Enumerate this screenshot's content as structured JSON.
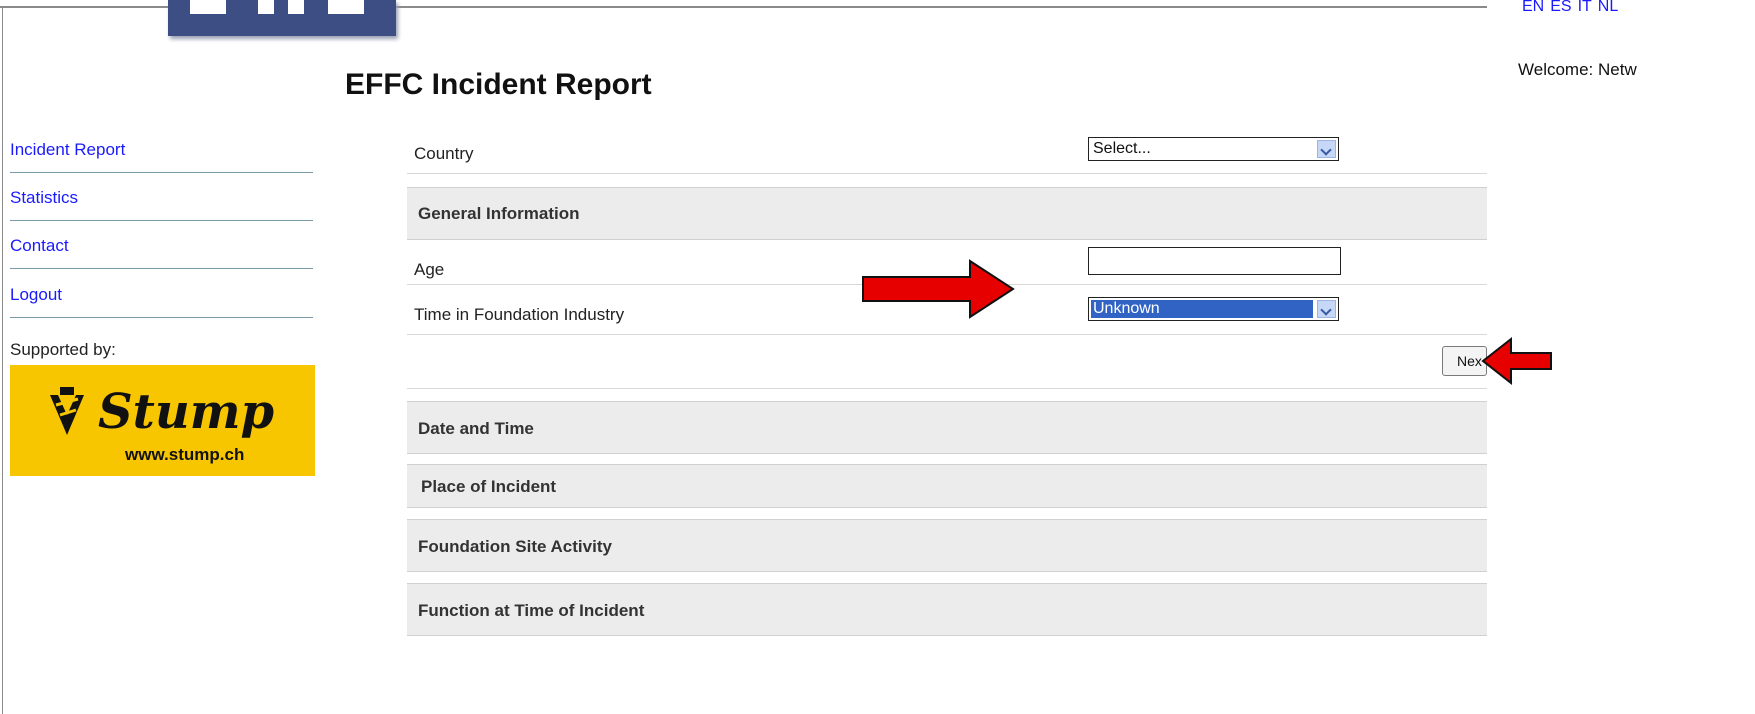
{
  "header": {
    "languages": [
      "EN",
      "ES",
      "IT",
      "NL"
    ],
    "welcome": "Welcome: Netw"
  },
  "page": {
    "title": "EFFC Incident Report"
  },
  "sidebar": {
    "items": [
      {
        "label": "Incident Report"
      },
      {
        "label": "Statistics"
      },
      {
        "label": "Contact"
      },
      {
        "label": "Logout"
      }
    ],
    "supported_label": "Supported by:",
    "sponsor": {
      "name": "Stump",
      "url": "www.stump.ch"
    }
  },
  "form": {
    "country": {
      "label": "Country",
      "selected": "Select..."
    },
    "general_section": "General Information",
    "age": {
      "label": "Age",
      "value": ""
    },
    "time_in_industry": {
      "label": "Time in Foundation Industry",
      "selected": "Unknown"
    },
    "next_label": "Nex",
    "sections": [
      "Date and Time",
      "Place of Incident",
      "Foundation Site Activity",
      "Function at Time of Incident"
    ]
  },
  "colors": {
    "link": "#1a1aff",
    "section_bg": "#ececec",
    "sponsor_bg": "#f8c600",
    "highlight": "#3163c5",
    "annotation_arrow": "#e60000"
  },
  "icons": [
    "dropdown-arrow-icon",
    "annotation-arrow-icon",
    "stump-drill-logo-icon"
  ]
}
